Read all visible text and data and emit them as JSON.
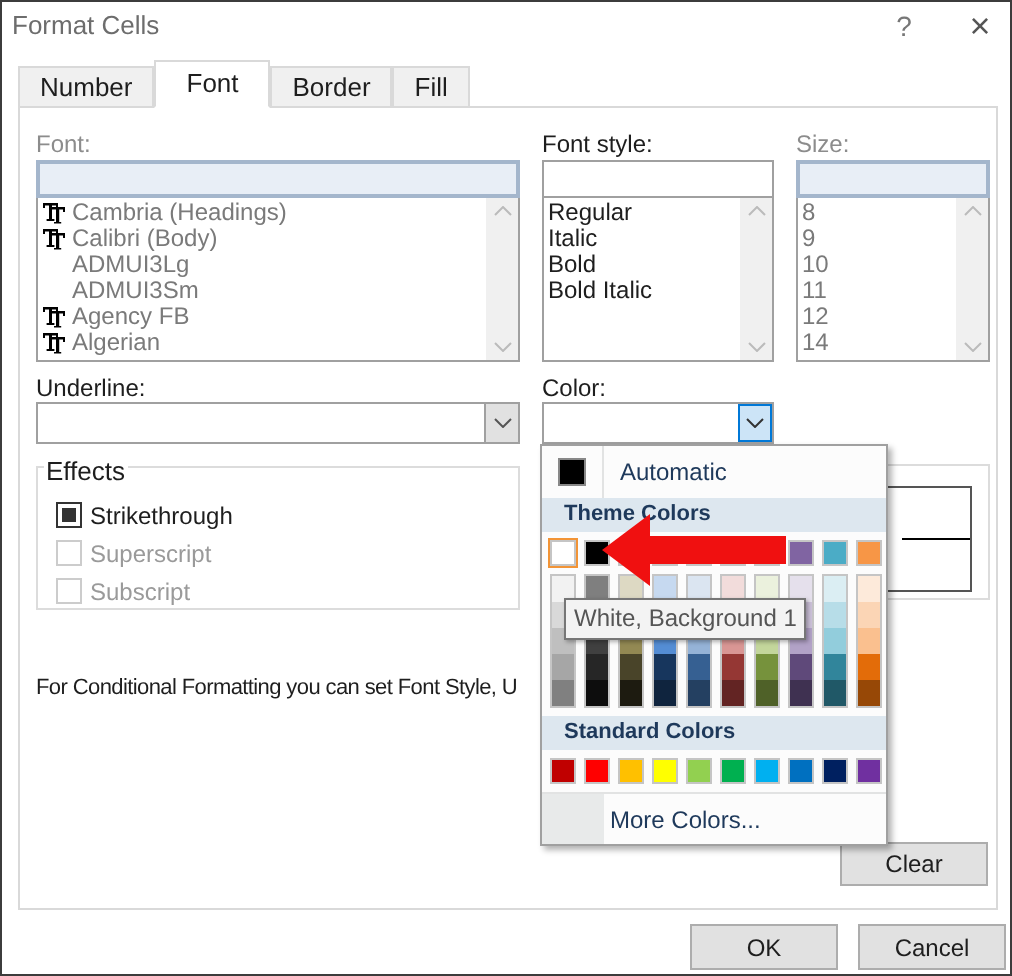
{
  "window": {
    "title": "Format Cells",
    "help": "?",
    "close": "×"
  },
  "tabs": [
    {
      "label": "Number",
      "selected": false
    },
    {
      "label": "Font",
      "selected": true
    },
    {
      "label": "Border",
      "selected": false
    },
    {
      "label": "Fill",
      "selected": false
    }
  ],
  "font": {
    "label": "Font:",
    "items": [
      {
        "name": "Cambria (Headings)",
        "truetype": true
      },
      {
        "name": "Calibri (Body)",
        "truetype": true
      },
      {
        "name": "ADMUI3Lg",
        "truetype": false
      },
      {
        "name": "ADMUI3Sm",
        "truetype": false
      },
      {
        "name": "Agency FB",
        "truetype": true
      },
      {
        "name": "Algerian",
        "truetype": true
      }
    ]
  },
  "font_style": {
    "label": "Font style:",
    "items": [
      "Regular",
      "Italic",
      "Bold",
      "Bold Italic"
    ]
  },
  "size": {
    "label": "Size:",
    "items": [
      "8",
      "9",
      "10",
      "11",
      "12",
      "14"
    ]
  },
  "underline": {
    "label": "Underline:"
  },
  "color": {
    "label": "Color:"
  },
  "effects": {
    "title": "Effects",
    "items": [
      {
        "label": "Strikethrough",
        "checked": true,
        "disabled": false
      },
      {
        "label": "Superscript",
        "checked": false,
        "disabled": true
      },
      {
        "label": "Subscript",
        "checked": false,
        "disabled": true
      }
    ]
  },
  "note": "For Conditional Formatting you can set Font Style, U",
  "buttons": {
    "clear": "Clear",
    "ok": "OK",
    "cancel": "Cancel"
  },
  "color_menu": {
    "automatic": "Automatic",
    "theme_title": "Theme Colors",
    "theme_colors": [
      {
        "color": "#ffffff",
        "selected": true
      },
      {
        "color": "#000000",
        "selected": false
      },
      {
        "selected": false
      },
      {
        "selected": false
      },
      {
        "selected": false
      },
      {
        "selected": false
      },
      {
        "selected": false
      },
      {
        "color": "#8064a2",
        "selected": false
      },
      {
        "color": "#4bacc6",
        "selected": false
      },
      {
        "color": "#f79646",
        "selected": false
      }
    ],
    "shades": [
      {
        "kind": "full",
        "upper": [
          {
            "color": "#f2f2f2"
          },
          {
            "color": "#d9d9d9"
          },
          {
            "color": "#bfbfbf"
          },
          {
            "color": "#a6a6a6"
          },
          {
            "color": "#808080"
          }
        ]
      },
      {
        "kind": "split",
        "upper": [
          {
            "color": "#7f7f7f"
          }
        ],
        "lower": [
          {
            "color": "#404040"
          },
          {
            "color": "#262626"
          },
          {
            "color": "#0d0d0d"
          }
        ]
      },
      {
        "kind": "split",
        "upper": [
          {
            "color": "#ddd9c3"
          }
        ],
        "lower": [
          {
            "color": "#938953"
          },
          {
            "color": "#494429"
          },
          {
            "color": "#1d1b10"
          }
        ]
      },
      {
        "kind": "split",
        "upper": [
          {
            "color": "#c6d9f0"
          }
        ],
        "lower": [
          {
            "color": "#548dd4"
          },
          {
            "color": "#17365d"
          },
          {
            "color": "#0f243e"
          }
        ]
      },
      {
        "kind": "split",
        "upper": [
          {
            "color": "#dbe5f1"
          }
        ],
        "lower": [
          {
            "color": "#95b3d7"
          },
          {
            "color": "#366092"
          },
          {
            "color": "#244061"
          }
        ]
      },
      {
        "kind": "split",
        "upper": [
          {
            "color": "#f2dcdb"
          }
        ],
        "lower": [
          {
            "color": "#d99694"
          },
          {
            "color": "#953734"
          },
          {
            "color": "#632423"
          }
        ]
      },
      {
        "kind": "split",
        "upper": [
          {
            "color": "#ebf1dd"
          }
        ],
        "lower": [
          {
            "color": "#c3d69b"
          },
          {
            "color": "#76923c"
          },
          {
            "color": "#4f6128"
          }
        ]
      },
      {
        "kind": "full",
        "upper": [
          {
            "color": "#e5e0ec"
          },
          {
            "color": "#ccc1d9"
          },
          {
            "color": "#b2a2c7"
          },
          {
            "color": "#5f497a"
          },
          {
            "color": "#3f3151"
          }
        ]
      },
      {
        "kind": "full",
        "upper": [
          {
            "color": "#dbeef3"
          },
          {
            "color": "#b7dde8"
          },
          {
            "color": "#92cddc"
          },
          {
            "color": "#31859b"
          },
          {
            "color": "#205867"
          }
        ]
      },
      {
        "kind": "full",
        "upper": [
          {
            "color": "#fdeada"
          },
          {
            "color": "#fbd5b5"
          },
          {
            "color": "#fac08f"
          },
          {
            "color": "#e36c09"
          },
          {
            "color": "#974806"
          }
        ]
      }
    ],
    "standard_title": "Standard Colors",
    "standard_colors": [
      {
        "color": "#c00000"
      },
      {
        "color": "#ff0000"
      },
      {
        "color": "#ffc000"
      },
      {
        "color": "#ffff00"
      },
      {
        "color": "#92d050"
      },
      {
        "color": "#00b050"
      },
      {
        "color": "#00b0f0"
      },
      {
        "color": "#0070c0"
      },
      {
        "color": "#002060"
      },
      {
        "color": "#7030a0"
      }
    ],
    "more": "More Colors...",
    "tooltip": "White, Background 1"
  }
}
